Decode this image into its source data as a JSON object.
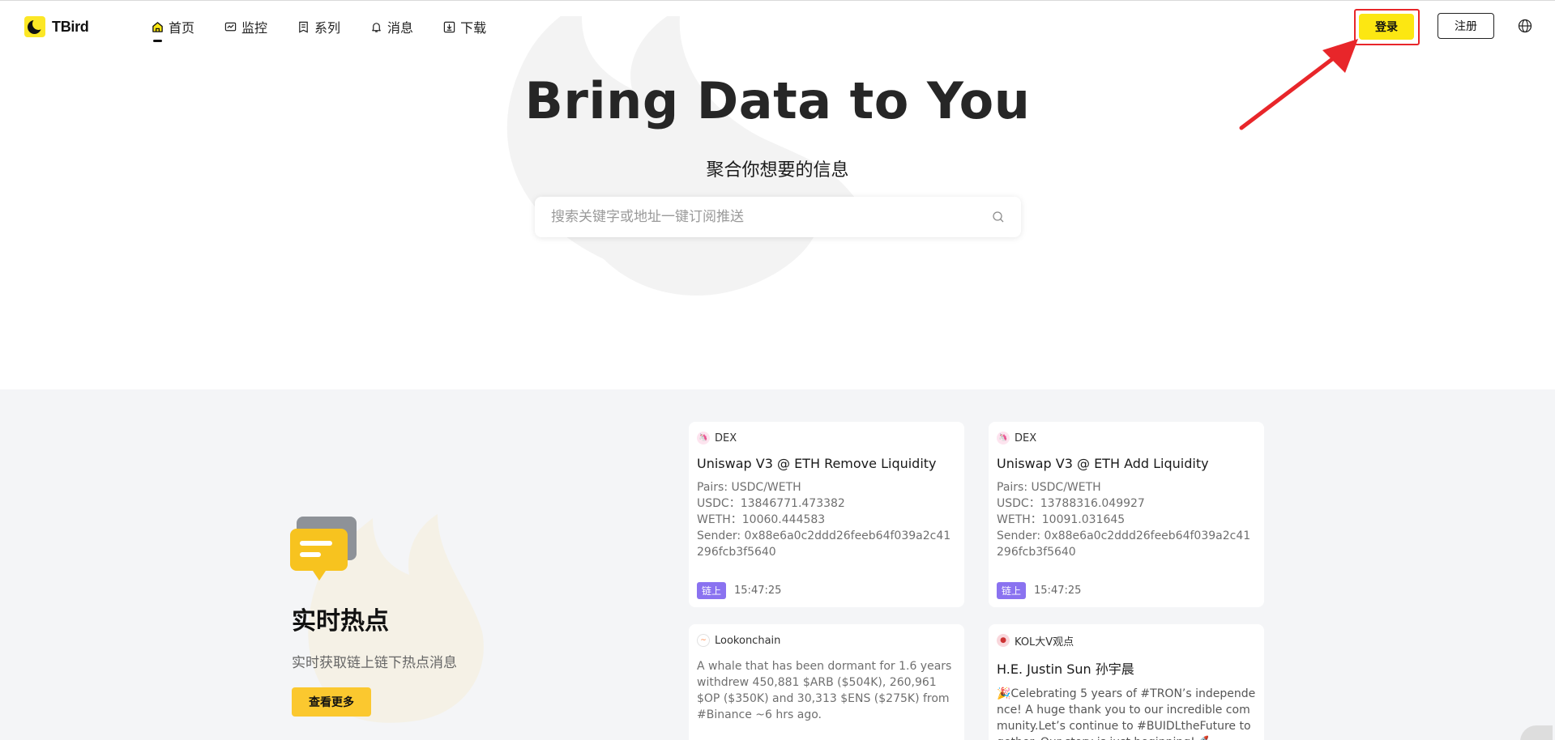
{
  "header": {
    "brand": "TBird",
    "nav": [
      {
        "label": "首页",
        "icon": "home-icon",
        "active": true
      },
      {
        "label": "监控",
        "icon": "monitor-icon",
        "active": false
      },
      {
        "label": "系列",
        "icon": "series-icon",
        "active": false
      },
      {
        "label": "消息",
        "icon": "bell-icon",
        "active": false
      },
      {
        "label": "下载",
        "icon": "download-icon",
        "active": false
      }
    ],
    "login_label": "登录",
    "register_label": "注册",
    "language_icon": "globe-icon"
  },
  "hero": {
    "title": "Bring Data to You",
    "subtitle": "聚合你想要的信息",
    "search_placeholder": "搜索关键字或地址一键订阅推送"
  },
  "hot": {
    "title": "实时热点",
    "description": "实时获取链上链下热点消息",
    "more_label": "查看更多"
  },
  "cards": [
    {
      "source": "DEX",
      "title": "Uniswap V3 @ ETH Remove Liquidity",
      "lines": [
        "Pairs: USDC/WETH",
        "USDC：13846771.473382",
        "WETH：10060.444583",
        "Sender: 0x88e6a0c2ddd26feeb64f039a2c41296fcb3f5640"
      ],
      "tag": "链上",
      "time": "15:47:25"
    },
    {
      "source": "DEX",
      "title": "Uniswap V3 @ ETH Add Liquidity",
      "lines": [
        "Pairs: USDC/WETH",
        "USDC：13788316.049927",
        "WETH：10091.031645",
        "Sender: 0x88e6a0c2ddd26feeb64f039a2c41296fcb3f5640"
      ],
      "tag": "链上",
      "time": "15:47:25"
    },
    {
      "source": "Lookonchain",
      "text": "A whale that has been dormant for 1.6 years withdrew 450,881 $ARB ($504K), 260,961 $OP ($350K) and 30,313 $ENS ($275K) from #Binance ~6 hrs ago."
    },
    {
      "source": "KOL大V观点",
      "title": "H.E. Justin Sun 孙宇晨",
      "text": "🎉Celebrating 5 years of #TRON’s independence! A huge thank you to our incredible community.Let’s continue to #BUIDLtheFuture together. Our story is just beginning!🚀"
    }
  ],
  "colors": {
    "brand_yellow": "#fce712",
    "highlight_red": "#e8262a",
    "section_bg": "#f4f5f7",
    "tag_purple": "#8a72f0",
    "more_button": "#fbc82f"
  }
}
